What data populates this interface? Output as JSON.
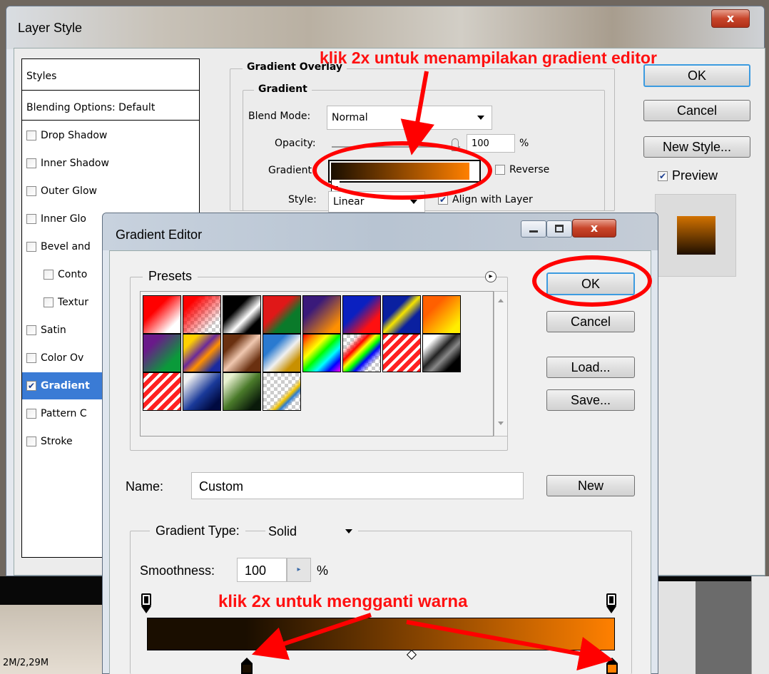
{
  "layer_style": {
    "title": "Layer Style",
    "close": "x",
    "styles_header": "Styles",
    "blending": "Blending Options: Default",
    "items": [
      {
        "label": "Drop Shadow",
        "checked": false,
        "indent": false
      },
      {
        "label": "Inner Shadow",
        "checked": false,
        "indent": false
      },
      {
        "label": "Outer Glow",
        "checked": false,
        "indent": false
      },
      {
        "label": "Inner Glo",
        "checked": false,
        "indent": false
      },
      {
        "label": "Bevel and",
        "checked": false,
        "indent": false
      },
      {
        "label": "Conto",
        "checked": false,
        "indent": true
      },
      {
        "label": "Textur",
        "checked": false,
        "indent": true
      },
      {
        "label": "Satin",
        "checked": false,
        "indent": false
      },
      {
        "label": "Color Ov",
        "checked": false,
        "indent": false
      },
      {
        "label": "Gradient",
        "checked": true,
        "indent": false,
        "active": true
      },
      {
        "label": "Pattern C",
        "checked": false,
        "indent": false
      },
      {
        "label": "Stroke",
        "checked": false,
        "indent": false
      }
    ],
    "group_title": "Gradient Overlay",
    "sub_title": "Gradient",
    "blend_mode_label": "Blend Mode:",
    "blend_mode_value": "Normal",
    "opacity_label": "Opacity:",
    "opacity_value": "100",
    "opacity_unit": "%",
    "gradient_label": "Gradient:",
    "reverse_label": "Reverse",
    "style_label": "Style:",
    "style_value": "Linear",
    "align_label": "Align with Layer",
    "ok": "OK",
    "cancel": "Cancel",
    "new_style": "New Style...",
    "preview": "Preview",
    "status": "2M/2,29M"
  },
  "annotations": {
    "top": "klik 2x untuk menampilakan gradient editor",
    "bottom": "klik 2x untuk mengganti warna"
  },
  "gradient_editor": {
    "title": "Gradient Editor",
    "presets_label": "Presets",
    "ok": "OK",
    "cancel": "Cancel",
    "load": "Load...",
    "save": "Save...",
    "name_label": "Name:",
    "name_value": "Custom",
    "new": "New",
    "type_label": "Gradient Type:",
    "type_value": "Solid",
    "smoothness_label": "Smoothness:",
    "smoothness_value": "100",
    "smoothness_unit": "%",
    "gradient_colors": [
      "#1a0e00",
      "#ff8000"
    ]
  }
}
